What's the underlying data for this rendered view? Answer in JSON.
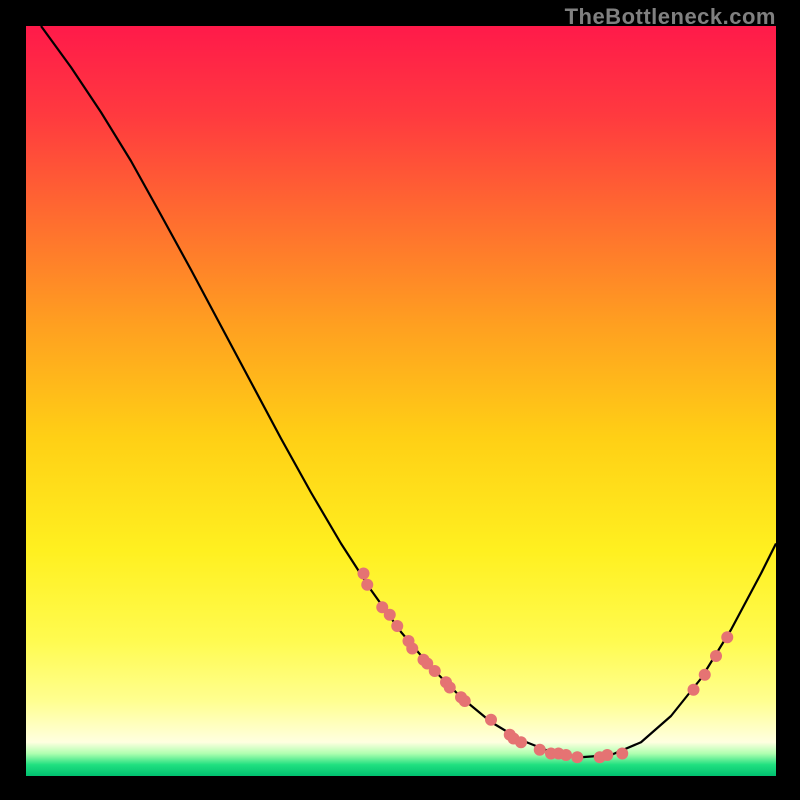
{
  "watermark": "TheBottleneck.com",
  "chart_data": {
    "type": "line",
    "title": "",
    "xlabel": "",
    "ylabel": "",
    "xlim": [
      0,
      100
    ],
    "ylim": [
      0,
      100
    ],
    "background_gradient": {
      "stops": [
        {
          "offset": 0.0,
          "color": "#ff1a4a"
        },
        {
          "offset": 0.12,
          "color": "#ff3a3f"
        },
        {
          "offset": 0.25,
          "color": "#ff6a30"
        },
        {
          "offset": 0.4,
          "color": "#ffa020"
        },
        {
          "offset": 0.55,
          "color": "#ffd015"
        },
        {
          "offset": 0.7,
          "color": "#fff020"
        },
        {
          "offset": 0.82,
          "color": "#fffb50"
        },
        {
          "offset": 0.9,
          "color": "#ffff90"
        },
        {
          "offset": 0.955,
          "color": "#ffffe0"
        },
        {
          "offset": 0.97,
          "color": "#b0ffb0"
        },
        {
          "offset": 0.985,
          "color": "#20e080"
        },
        {
          "offset": 1.0,
          "color": "#00c070"
        }
      ]
    },
    "curve": [
      {
        "x": 2.0,
        "y": 100.0
      },
      {
        "x": 6.0,
        "y": 94.5
      },
      {
        "x": 10.0,
        "y": 88.5
      },
      {
        "x": 14.0,
        "y": 82.0
      },
      {
        "x": 18.0,
        "y": 74.8
      },
      {
        "x": 22.0,
        "y": 67.5
      },
      {
        "x": 26.0,
        "y": 60.0
      },
      {
        "x": 30.0,
        "y": 52.5
      },
      {
        "x": 34.0,
        "y": 45.0
      },
      {
        "x": 38.0,
        "y": 37.8
      },
      {
        "x": 42.0,
        "y": 31.0
      },
      {
        "x": 46.0,
        "y": 24.8
      },
      {
        "x": 50.0,
        "y": 19.2
      },
      {
        "x": 54.0,
        "y": 14.5
      },
      {
        "x": 58.0,
        "y": 10.5
      },
      {
        "x": 62.0,
        "y": 7.2
      },
      {
        "x": 66.0,
        "y": 4.8
      },
      {
        "x": 70.0,
        "y": 3.2
      },
      {
        "x": 74.0,
        "y": 2.5
      },
      {
        "x": 78.0,
        "y": 2.8
      },
      {
        "x": 82.0,
        "y": 4.5
      },
      {
        "x": 86.0,
        "y": 8.0
      },
      {
        "x": 90.0,
        "y": 13.0
      },
      {
        "x": 94.0,
        "y": 19.5
      },
      {
        "x": 98.0,
        "y": 27.0
      },
      {
        "x": 100.0,
        "y": 31.0
      }
    ],
    "points": [
      {
        "x": 45.0,
        "y": 27.0
      },
      {
        "x": 45.5,
        "y": 25.5
      },
      {
        "x": 47.5,
        "y": 22.5
      },
      {
        "x": 48.5,
        "y": 21.5
      },
      {
        "x": 49.5,
        "y": 20.0
      },
      {
        "x": 51.0,
        "y": 18.0
      },
      {
        "x": 51.5,
        "y": 17.0
      },
      {
        "x": 53.0,
        "y": 15.5
      },
      {
        "x": 53.5,
        "y": 15.0
      },
      {
        "x": 54.5,
        "y": 14.0
      },
      {
        "x": 56.0,
        "y": 12.5
      },
      {
        "x": 56.5,
        "y": 11.8
      },
      {
        "x": 58.0,
        "y": 10.5
      },
      {
        "x": 58.5,
        "y": 10.0
      },
      {
        "x": 62.0,
        "y": 7.5
      },
      {
        "x": 64.5,
        "y": 5.5
      },
      {
        "x": 65.0,
        "y": 5.0
      },
      {
        "x": 66.0,
        "y": 4.5
      },
      {
        "x": 68.5,
        "y": 3.5
      },
      {
        "x": 70.0,
        "y": 3.0
      },
      {
        "x": 71.0,
        "y": 3.0
      },
      {
        "x": 72.0,
        "y": 2.8
      },
      {
        "x": 73.5,
        "y": 2.5
      },
      {
        "x": 76.5,
        "y": 2.5
      },
      {
        "x": 77.5,
        "y": 2.8
      },
      {
        "x": 79.5,
        "y": 3.0
      },
      {
        "x": 89.0,
        "y": 11.5
      },
      {
        "x": 90.5,
        "y": 13.5
      },
      {
        "x": 92.0,
        "y": 16.0
      },
      {
        "x": 93.5,
        "y": 18.5
      }
    ],
    "point_color": "#e57373",
    "curve_color": "#000000",
    "curve_width": 2.2,
    "point_radius": 6
  }
}
